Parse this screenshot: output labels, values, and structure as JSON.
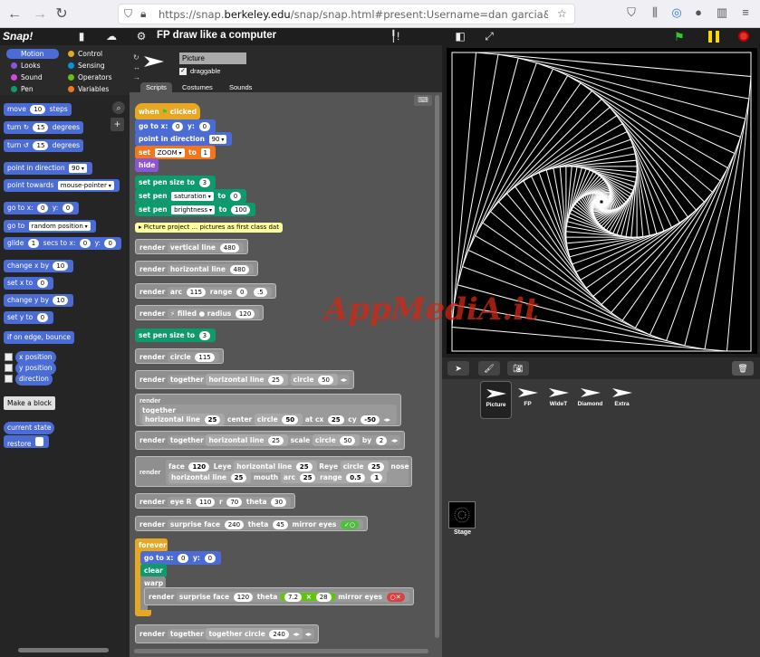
{
  "browser": {
    "url_prefix": "https://snap.",
    "url_domain": "berkeley.edu",
    "url_rest": "/snap/snap.html#present:Username=dan garcia&ProjectName=FP draw like"
  },
  "snap": {
    "logo": "Snap!",
    "project_title": "FP draw like a computer"
  },
  "categories": [
    {
      "label": "Motion",
      "color": "#4a6cd4"
    },
    {
      "label": "Looks",
      "color": "#8a55d7"
    },
    {
      "label": "Sound",
      "color": "#cf4ad9"
    },
    {
      "label": "Pen",
      "color": "#0e9a6c"
    },
    {
      "label": "Control",
      "color": "#e6a822"
    },
    {
      "label": "Sensing",
      "color": "#0494dc"
    },
    {
      "label": "Operators",
      "color": "#62c213"
    },
    {
      "label": "Variables",
      "color": "#f3761d"
    }
  ],
  "palette": {
    "move": "move",
    "move_n": "10",
    "move_steps": "steps",
    "turn": "turn",
    "turn_n": "15",
    "degrees": "degrees",
    "point_dir": "point in direction",
    "dir_val": "90",
    "point_towards": "point towards",
    "mouse_pointer": "mouse-pointer",
    "go_to_xy": "go to x:",
    "y_label": "y:",
    "zero": "0",
    "go_to": "go to",
    "random_position": "random position",
    "glide": "glide",
    "glide_n": "1",
    "secs_to_x": "secs to x:",
    "change_x": "change x by",
    "ten": "10",
    "set_x": "set x to",
    "change_y": "change y by",
    "set_y": "set y to",
    "if_edge": "if on edge, bounce",
    "x_position": "x position",
    "y_position": "y position",
    "direction": "direction",
    "make_block": "Make a block",
    "current_state": "current state",
    "restore": "restore"
  },
  "sprite": {
    "name": "Picture",
    "draggable_label": "draggable",
    "tabs": [
      "Scripts",
      "Costumes",
      "Sounds"
    ]
  },
  "scripts": {
    "when": "when",
    "clicked": "clicked",
    "go_to_x": "go to x:",
    "y": "y:",
    "zero": "0",
    "point_in_direction": "point in direction",
    "ninety": "90",
    "set": "set",
    "zoom": "ZOOM",
    "to": "to",
    "one": "1",
    "hide": "hide",
    "set_pen_size_to": "set pen size to",
    "three": "3",
    "set_pen": "set pen",
    "saturation": "saturation",
    "brightness": "brightness",
    "hundred": "100",
    "comment": "Picture project ... pictures as first class dat",
    "render": "render",
    "vertical_line": "vertical line",
    "n480": "480",
    "horizontal_line": "horizontal line",
    "arc": "arc",
    "n115": "115",
    "range": "range",
    "n0": "0",
    "n5": ".5",
    "filled": "filled",
    "radius": "radius",
    "n120": "120",
    "circle": "circle",
    "together": "together",
    "n25": "25",
    "n50": "50",
    "center": "center",
    "at_cx": "at cx",
    "cy": "cy",
    "neg50": "-50",
    "scale": "scale",
    "by": "by",
    "n2": "2",
    "face": "face",
    "leye": "Leye",
    "reye": "Reye",
    "nose": "nose",
    "mouth": "mouth",
    "n05": "0.5",
    "n1": "1",
    "eye_r": "eye R",
    "n110": "110",
    "r": "r",
    "n70": "70",
    "theta": "theta",
    "n30": "30",
    "surprise_face": "surprise face",
    "n240": "240",
    "n45": "45",
    "mirror_eyes": "mirror eyes",
    "forever": "forever",
    "clear": "clear",
    "warp": "warp",
    "n72": "7.2",
    "times": "×",
    "n28": "28"
  },
  "corral": {
    "sprites": [
      "Picture",
      "FP",
      "WideT",
      "Diamond",
      "Extra"
    ],
    "stage_label": "Stage"
  },
  "watermark": "AppMediA.it"
}
